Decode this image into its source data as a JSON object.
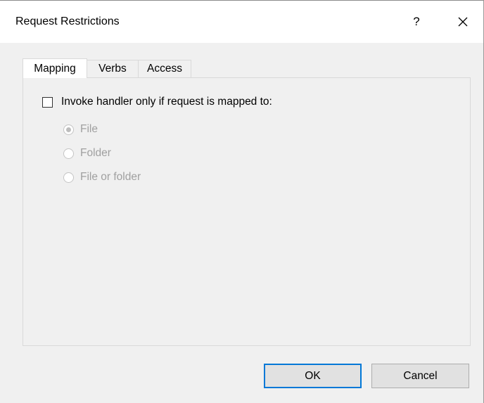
{
  "window": {
    "title": "Request Restrictions",
    "help_label": "?"
  },
  "tabs": [
    {
      "label": "Mapping",
      "active": true
    },
    {
      "label": "Verbs",
      "active": false
    },
    {
      "label": "Access",
      "active": false
    }
  ],
  "mapping": {
    "checkbox_label": "Invoke handler only if request is mapped to:",
    "checkbox_checked": false,
    "options": [
      {
        "label": "File",
        "selected": true,
        "enabled": false
      },
      {
        "label": "Folder",
        "selected": false,
        "enabled": false
      },
      {
        "label": "File or folder",
        "selected": false,
        "enabled": false
      }
    ]
  },
  "buttons": {
    "ok_label": "OK",
    "cancel_label": "Cancel"
  },
  "icons": {
    "close": "close-icon"
  },
  "colors": {
    "accent": "#0078d7",
    "dialog_bg": "#f0f0f0",
    "disabled_text": "#a0a0a0"
  }
}
